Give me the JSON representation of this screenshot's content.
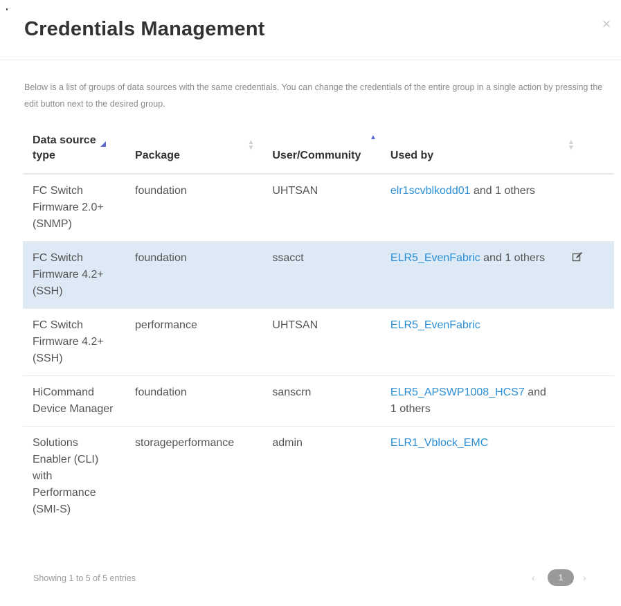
{
  "modal": {
    "title": "Credentials Management",
    "close_label": "×",
    "description": "Below is a list of groups of data sources with the same credentials. You can change the credentials of the entire group in a single action by pressing the edit button next to the desired group."
  },
  "table": {
    "headers": {
      "type": "Data source type",
      "package": "Package",
      "user": "User/Community",
      "used_by": "Used by"
    },
    "rows": [
      {
        "type": "FC Switch Firmware 2.0+ (SNMP)",
        "package": "foundation",
        "user": "UHTSAN",
        "used_by_link": "elr1scvblkodd01",
        "used_by_suffix": " and 1 others",
        "selected": false
      },
      {
        "type": "FC Switch Firmware 4.2+ (SSH)",
        "package": "foundation",
        "user": "ssacct",
        "used_by_link": "ELR5_EvenFabric",
        "used_by_suffix": " and 1 others",
        "selected": true
      },
      {
        "type": "FC Switch Firmware 4.2+ (SSH)",
        "package": "performance",
        "user": "UHTSAN",
        "used_by_link": "ELR5_EvenFabric",
        "used_by_suffix": "",
        "selected": false
      },
      {
        "type": "HiCommand Device Manager",
        "package": "foundation",
        "user": "sanscrn",
        "used_by_link": "ELR5_APSWP1008_HCS7",
        "used_by_suffix": " and 1 others",
        "selected": false
      },
      {
        "type": "Solutions Enabler (CLI) with Performance (SMI-S)",
        "package": "storageperformance",
        "user": "admin",
        "used_by_link": "ELR1_Vblock_EMC",
        "used_by_suffix": "",
        "selected": false
      }
    ]
  },
  "footer": {
    "entries_info": "Showing 1 to 5 of 5 entries",
    "prev_label": "‹",
    "page": "1",
    "next_label": "›"
  },
  "icons": {
    "close": "close-icon",
    "edit": "edit-icon",
    "sort": "sort-icon",
    "sort_asc": "sort-ascending-icon"
  },
  "colors": {
    "link": "#2c8fd6",
    "selected_row": "#dde9f5",
    "sort_active": "#5b6ad0"
  }
}
